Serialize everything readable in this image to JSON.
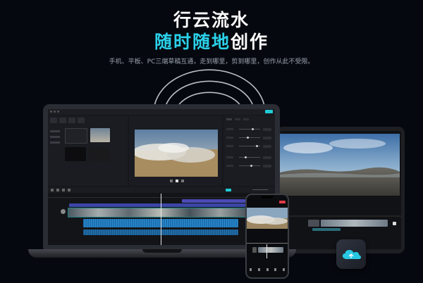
{
  "hero": {
    "title_line1": "行云流水",
    "title_line2_accent": "随时随地",
    "title_line2_rest": "创作",
    "subtitle": "手机、平板、PC三端草稿互通，走到哪里，剪到哪里，创作从此不受限。"
  },
  "colors": {
    "background": "#06080f",
    "accent": "#2ad0e8",
    "clip_blue": "#1e6fb0",
    "clip_purple": "#4b4bb5",
    "clip_teal": "#1b7f7f"
  },
  "icons": [
    "cloud-icon",
    "play-icon",
    "export-icon"
  ]
}
